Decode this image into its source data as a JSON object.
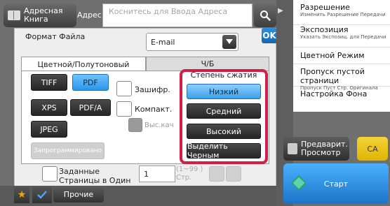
{
  "header": {
    "address_book_label": "Адресная Книга",
    "address_label": "Адрес",
    "address_placeholder": "Коснитесь для Ввода Адреса"
  },
  "panel": {
    "ok_label": "OK",
    "format_title": "Формат Файла",
    "format_value": "E-mail",
    "tabs": [
      {
        "label": "Цветной/Полутоновый",
        "active": true
      },
      {
        "label": "Ч/Б",
        "active": false
      }
    ],
    "formats": [
      {
        "label": "TIFF",
        "selected": false
      },
      {
        "label": "PDF",
        "selected": true
      },
      {
        "label": "XPS",
        "selected": false
      },
      {
        "label": "PDF/A",
        "selected": false
      },
      {
        "label": "JPEG",
        "selected": false
      },
      {
        "label": "Запрограммировано",
        "selected": false,
        "disabled": true
      }
    ],
    "options": {
      "encrypt": "Зашифр.",
      "compact": "Компакт.",
      "high_quality": "Выс.кач"
    },
    "compression": {
      "title": "Степень сжатия",
      "buttons": [
        "Низкий",
        "Средний",
        "Высокий",
        "Выделить Черным"
      ],
      "selected": "Низкий"
    },
    "pages": {
      "label": "Заданные Страницы в Один Файл",
      "value": "1",
      "range": "(1~99 ) Стр."
    }
  },
  "bottom": {
    "other_label": "Прочие"
  },
  "sidebar": {
    "items": [
      {
        "title": "Разрешение",
        "sub": "Изменить Разрешение Передачи"
      },
      {
        "title": "Экспозиция",
        "sub": "Указать Экспозиц. для Передачи"
      },
      {
        "title": "Цветной Режим",
        "sub": ""
      },
      {
        "title": "Пропуск пустой страници",
        "sub": "Пропуск Пуст Стр. Оригинала"
      },
      {
        "title": "Настройка Фона",
        "sub": ""
      }
    ],
    "preview_label": "Предварит. Просмотр",
    "ca_label": "CA",
    "start_label": "Старт"
  }
}
